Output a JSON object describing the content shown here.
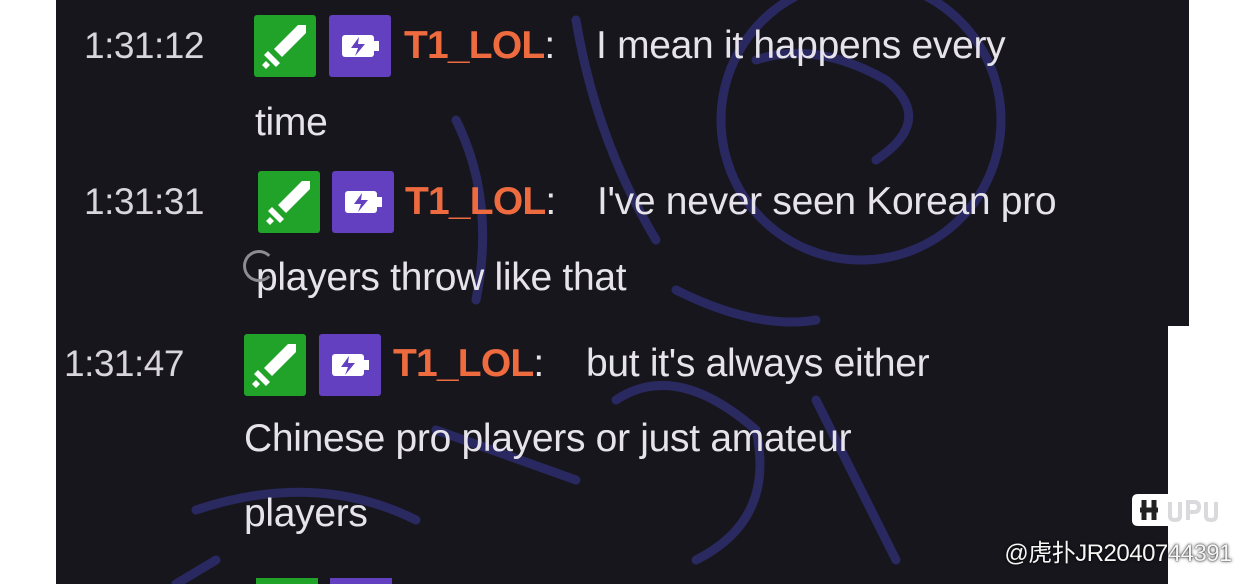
{
  "chat": {
    "messages": [
      {
        "timestamp": "1:31:12",
        "username": "T1_LOL",
        "colon": ":",
        "line1": "I mean it happens every",
        "line2": "time"
      },
      {
        "timestamp": "1:31:31",
        "username": "T1_LOL",
        "colon": ":",
        "line1": "I've never seen Korean pro",
        "line2": "players throw like that"
      },
      {
        "timestamp": "1:31:47",
        "username": "T1_LOL",
        "colon": ":",
        "line1": "but it's always either",
        "line2": "Chinese pro players or just amateur",
        "line3": "players"
      }
    ],
    "badges": [
      "sword-badge-icon",
      "turbo-badge-icon"
    ],
    "colors": {
      "background": "#17161d",
      "username": "#ee6b3f",
      "text": "#e6e4ea",
      "sword_badge": "#21a32a",
      "turbo_badge": "#6240c0"
    }
  },
  "watermark": {
    "logo_text": "HUPU",
    "text": "@虎扑JR2040744391"
  }
}
